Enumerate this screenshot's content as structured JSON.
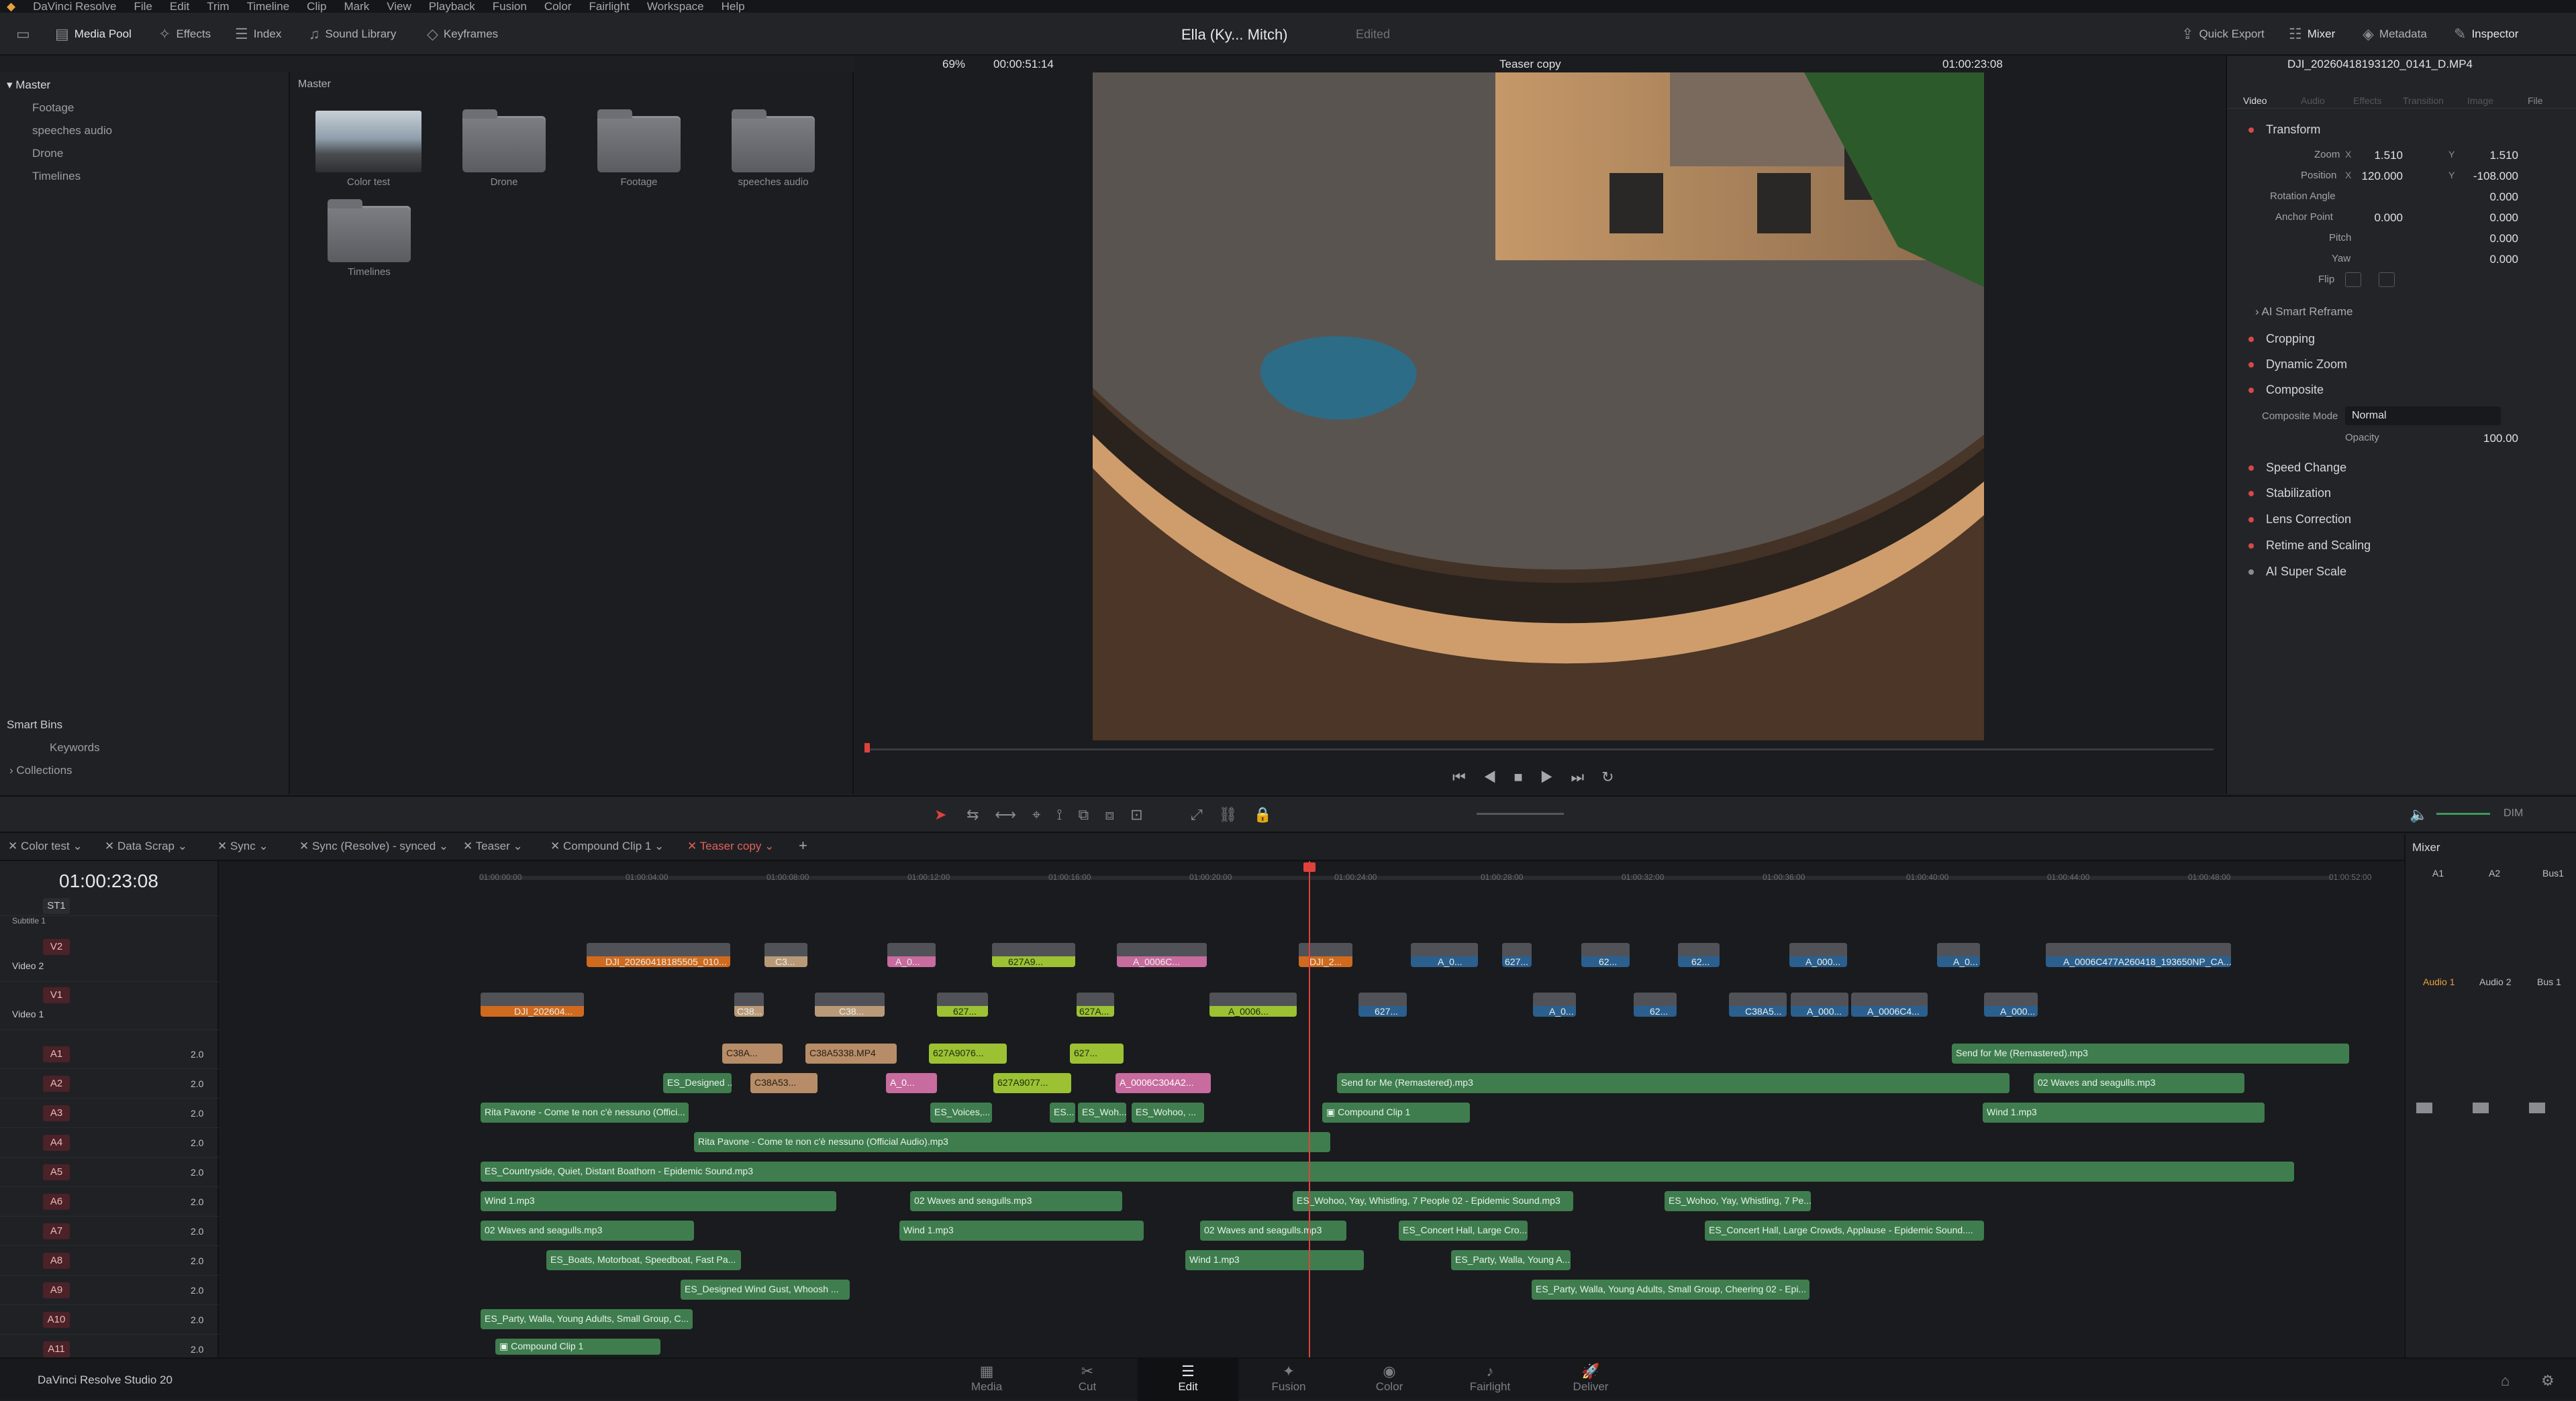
{
  "menubar": {
    "app": "DaVinci Resolve",
    "items": [
      "File",
      "Edit",
      "Trim",
      "Timeline",
      "Clip",
      "Mark",
      "View",
      "Playback",
      "Fusion",
      "Color",
      "Fairlight",
      "Workspace",
      "Help"
    ]
  },
  "toolbar": {
    "media_pool": "Media Pool",
    "effects": "Effects",
    "index": "Index",
    "sound_library": "Sound Library",
    "keyframes": "Keyframes",
    "project_title": "Ella (Ky... Mitch)",
    "edited": "Edited",
    "quick_export": "Quick Export",
    "mixer": "Mixer",
    "metadata": "Metadata",
    "inspector": "Inspector"
  },
  "sidebar": {
    "root": "Master",
    "items": [
      "Footage",
      "speeches audio",
      "Drone",
      "Timelines"
    ],
    "smart_bins": "Smart Bins",
    "keywords": "Keywords",
    "collections": "Collections"
  },
  "media_pool": {
    "header": "Master",
    "items": [
      {
        "label": "Color test"
      },
      {
        "label": "Drone"
      },
      {
        "label": "Footage"
      },
      {
        "label": "speeches audio"
      },
      {
        "label": "Timelines"
      }
    ]
  },
  "viewer": {
    "zoom": "69%",
    "timecode_left": "00:00:51:14",
    "timeline_name": "Teaser copy",
    "timecode_right": "01:00:23:08"
  },
  "inspector": {
    "clip_name": "DJI_20260418193120_0141_D.MP4",
    "tabs": [
      "Video",
      "Audio",
      "Effects",
      "Transition",
      "Image",
      "File"
    ],
    "sections": {
      "transform": "Transform",
      "ai_smart_reframe": "AI Smart Reframe",
      "cropping": "Cropping",
      "dynamic_zoom": "Dynamic Zoom",
      "composite": "Composite",
      "speed_change": "Speed Change",
      "stabilization": "Stabilization",
      "lens_correction": "Lens Correction",
      "retime_scaling": "Retime and Scaling",
      "ai_super_scale": "AI Super Scale"
    },
    "fields": {
      "zoom_label": "Zoom",
      "zoom_x": "1.510",
      "zoom_y": "1.510",
      "position_label": "Position",
      "position_x": "120.000",
      "position_y": "-108.000",
      "rotation_label": "Rotation Angle",
      "rotation": "0.000",
      "anchor_label": "Anchor Point",
      "anchor_x": "0.000",
      "anchor_y": "0.000",
      "pitch_label": "Pitch",
      "pitch": "0.000",
      "yaw_label": "Yaw",
      "yaw": "0.000",
      "flip_label": "Flip",
      "composite_mode_label": "Composite Mode",
      "composite_mode": "Normal",
      "opacity_label": "Opacity",
      "opacity": "100.00",
      "x": "X",
      "y": "Y"
    }
  },
  "timeline": {
    "timecode": "01:00:23:08",
    "tabs": [
      "Color test",
      "Data Scrap",
      "Sync",
      "Sync (Resolve) - synced",
      "Teaser",
      "Compound Clip 1",
      "Teaser copy"
    ],
    "ruler": [
      "01:00:00:00",
      "01:00:04:00",
      "01:00:08:00",
      "01:00:12:00",
      "01:00:16:00",
      "01:00:20:00",
      "01:00:24:00",
      "01:00:28:00",
      "01:00:32:00",
      "01:00:36:00",
      "01:00:40:00",
      "01:00:44:00",
      "01:00:48:00",
      "01:00:52:00"
    ],
    "tracks": [
      {
        "id": "ST1",
        "name": "Subtitle 1"
      },
      {
        "id": "V2",
        "name": "Video 2"
      },
      {
        "id": "V1",
        "name": "Video 1"
      },
      {
        "id": "A1",
        "vol": "2.0"
      },
      {
        "id": "A2",
        "vol": "2.0"
      },
      {
        "id": "A3",
        "vol": "2.0"
      },
      {
        "id": "A4",
        "vol": "2.0"
      },
      {
        "id": "A5",
        "vol": "2.0"
      },
      {
        "id": "A6",
        "vol": "2.0"
      },
      {
        "id": "A7",
        "vol": "2.0"
      },
      {
        "id": "A8",
        "vol": "2.0"
      },
      {
        "id": "A9",
        "vol": "2.0"
      },
      {
        "id": "A10",
        "vol": "2.0"
      },
      {
        "id": "A11",
        "vol": "2.0"
      }
    ],
    "clips": {
      "v2_1": "DJI_20260418185505_010...",
      "v2_2": "C3...",
      "v2_3": "A_0...",
      "v2_4": "627A9...",
      "v2_5": "A_0006C...",
      "v2_6": "DJI_2...",
      "v2_7": "A_0...",
      "v2_8": "627...",
      "v2_9": "62...",
      "v2_10": "62...",
      "v2_11": "A_000...",
      "v2_12": "A_0...",
      "v2_13": "A_0006C477A260418_193650NP_CA...",
      "v1_1": "DJI_202604...",
      "v1_2": "C38...",
      "v1_3": "C38...",
      "v1_4": "627...",
      "v1_5": "627A...",
      "v1_6": "A_0006...",
      "v1_7": "627...",
      "v1_8": "A_0...",
      "v1_9": "62...",
      "v1_10": "C38A5...",
      "v1_11": "A_000...",
      "v1_12": "A_0006C4...",
      "v1_13": "A_000...",
      "a1_1": "C38A...",
      "a1_2": "C38A5338.MP4",
      "a1_3": "627A9076...",
      "a1_4": "627...",
      "a1_5": "Send for Me (Remastered).mp3",
      "a2_1": "ES_Designed ...",
      "a2_2": "C38A53...",
      "a2_3": "A_0...",
      "a2_4": "627A9077...",
      "a2_5": "A_0006C304A2...",
      "a2_6": "Send for Me (Remastered).mp3",
      "a2_7": "02 Waves and seagulls.mp3",
      "a3_1": "Rita Pavone - Come te non c'è nessuno (Offici...",
      "a3_2": "ES_Voices,...",
      "a3_3": "ES...",
      "a3_4": "ES_Woh...",
      "a3_5": "ES_Wohoo, ...",
      "a3_6": "Compound Clip 1",
      "a3_7": "Wind 1.mp3",
      "a4_1": "Rita Pavone - Come te non c'è nessuno (Official Audio).mp3",
      "a5_1": "ES_Countryside, Quiet, Distant Boathorn - Epidemic Sound.mp3",
      "a6_1": "Wind 1.mp3",
      "a6_2": "02 Waves and seagulls.mp3",
      "a6_3": "ES_Wohoo, Yay, Whistling, 7 People 02 - Epidemic Sound.mp3",
      "a6_4": "ES_Wohoo, Yay, Whistling, 7 Pe...",
      "a7_1": "02 Waves and seagulls.mp3",
      "a7_2": "Wind 1.mp3",
      "a7_3": "02 Waves and seagulls.mp3",
      "a7_4": "ES_Concert Hall, Large Cro...",
      "a7_5": "ES_Concert Hall, Large Crowds, Applause - Epidemic Sound....",
      "a8_1": "ES_Boats, Motorboat, Speedboat, Fast Pa...",
      "a8_2": "Wind 1.mp3",
      "a8_3": "ES_Party, Walla, Young A...",
      "a9_1": "ES_Designed Wind Gust, Whoosh ...",
      "a9_2": "ES_Party, Walla, Young Adults, Small Group, Cheering 02 - Epi...",
      "a10_1": "ES_Party, Walla, Young Adults, Small Group, C...",
      "a11_1": "Compound Clip 1"
    }
  },
  "mixer": {
    "title": "Mixer",
    "channels": [
      "A1",
      "A2",
      "Bus1"
    ],
    "labels": [
      "Audio 1",
      "Audio 2",
      "Bus 1"
    ],
    "dim": "DIM"
  },
  "pagebar": {
    "brand": "DaVinci Resolve Studio 20",
    "pages": [
      "Media",
      "Cut",
      "Edit",
      "Fusion",
      "Color",
      "Fairlight",
      "Deliver"
    ]
  }
}
